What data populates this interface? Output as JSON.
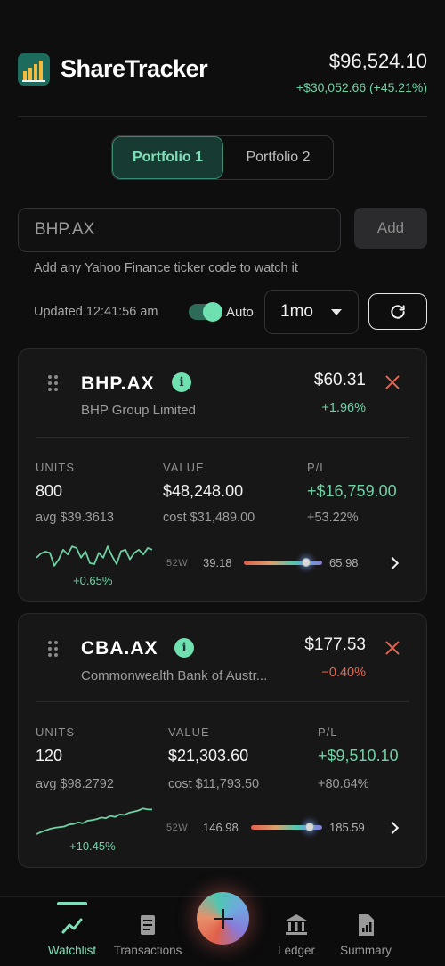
{
  "app": {
    "title": "ShareTracker",
    "total_value": "$96,524.10",
    "total_change": "+$30,052.66 (+45.21%)"
  },
  "portfolio_tabs": [
    {
      "label": "Portfolio 1",
      "active": true
    },
    {
      "label": "Portfolio 2",
      "active": false
    }
  ],
  "ticker": {
    "placeholder": "BHP.AX",
    "add_label": "Add",
    "hint": "Add any Yahoo Finance ticker code to watch it"
  },
  "controls": {
    "updated": "Updated 12:41:56 am",
    "auto_label": "Auto",
    "auto_enabled": true,
    "range": "1mo"
  },
  "holdings": [
    {
      "symbol": "BHP.AX",
      "company": "BHP Group Limited",
      "price": "$60.31",
      "change": "+1.96%",
      "change_positive": true,
      "units_label": "UNITS",
      "units": "800",
      "avg": "avg $39.3613",
      "value_label": "VALUE",
      "value": "$48,248.00",
      "cost": "cost $31,489.00",
      "pl_label": "P/L",
      "pl": "+$16,759.00",
      "pl_pct": "+53.22%",
      "spark_change": "+0.65%",
      "w52_label": "52W",
      "w52_low": "39.18",
      "w52_high": "65.98",
      "w52_position": 0.79,
      "spark": [
        0.55,
        0.42,
        0.36,
        0.4,
        0.8,
        0.6,
        0.3,
        0.45,
        0.2,
        0.25,
        0.55,
        0.35,
        0.72,
        0.75,
        0.4,
        0.55,
        0.2,
        0.5,
        0.75,
        0.35,
        0.3,
        0.6,
        0.4,
        0.3,
        0.45,
        0.25,
        0.3
      ]
    },
    {
      "symbol": "CBA.AX",
      "company": "Commonwealth Bank of Austr...",
      "price": "$177.53",
      "change": "−0.40%",
      "change_positive": false,
      "units_label": "UNITS",
      "units": "120",
      "avg": "avg $98.2792",
      "value_label": "VALUE",
      "value": "$21,303.60",
      "cost": "cost $11,793.50",
      "pl_label": "P/L",
      "pl": "+$9,510.10",
      "pl_pct": "+80.64%",
      "spark_change": "+10.45%",
      "w52_label": "52W",
      "w52_low": "146.98",
      "w52_high": "185.59",
      "w52_position": 0.82,
      "spark": [
        0.92,
        0.85,
        0.8,
        0.75,
        0.72,
        0.7,
        0.68,
        0.62,
        0.6,
        0.55,
        0.58,
        0.5,
        0.48,
        0.45,
        0.4,
        0.42,
        0.35,
        0.38,
        0.3,
        0.32,
        0.25,
        0.22,
        0.18,
        0.12,
        0.15,
        0.15
      ]
    }
  ],
  "nav": [
    {
      "label": "Watchlist",
      "icon": "chart-line-icon",
      "active": true
    },
    {
      "label": "Transactions",
      "icon": "receipt-icon",
      "active": false
    },
    {
      "label": "Ledger",
      "icon": "bank-icon",
      "active": false
    },
    {
      "label": "Summary",
      "icon": "document-chart-icon",
      "active": false
    }
  ],
  "colors": {
    "accent": "#7fe0b8",
    "positive": "#6fd1a3",
    "negative": "#e06652",
    "background": "#0e0e0f",
    "card": "#171718"
  }
}
